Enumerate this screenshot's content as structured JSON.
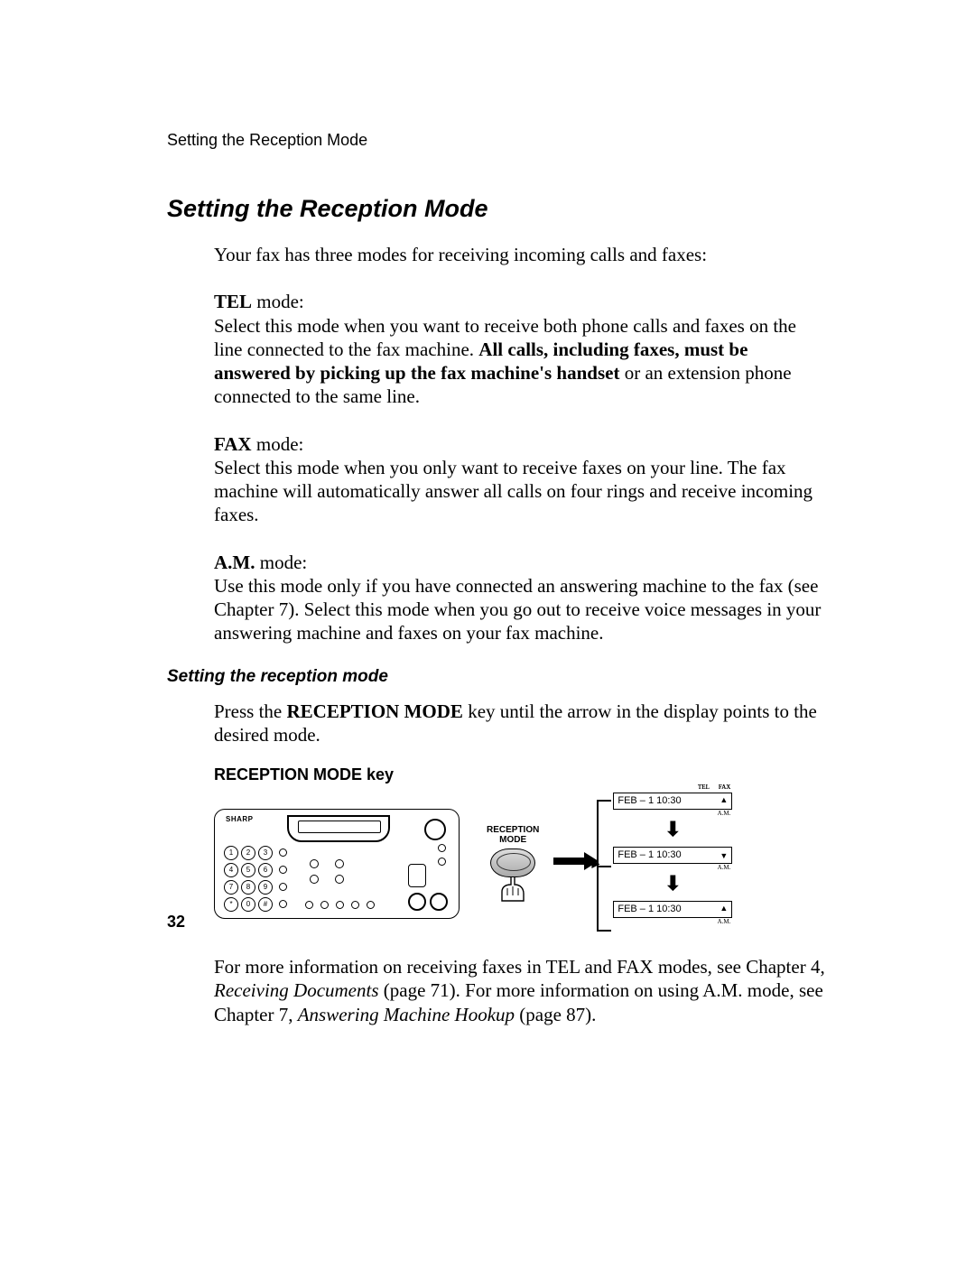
{
  "header": {
    "running": "Setting the Reception Mode"
  },
  "title": "Setting the Reception Mode",
  "intro": "Your fax has three modes for receiving incoming calls and faxes:",
  "modes": {
    "tel": {
      "label": "TEL",
      "suffix": " mode:",
      "body_a": "Select this mode when you want to receive both phone calls and faxes on the line connected to the fax machine. ",
      "body_bold": "All calls, including faxes, must be answered by picking up the fax machine's handset",
      "body_b": " or an extension phone connected to the same line."
    },
    "fax": {
      "label": "FAX",
      "suffix": " mode:",
      "body": "Select this mode when you only want to receive faxes on your line. The fax machine will automatically answer all calls on four rings and receive incoming faxes."
    },
    "am": {
      "label": "A.M.",
      "suffix": " mode:",
      "body": "Use this mode only if you have connected an answering machine to the fax (see Chapter 7). Select this mode when you go out to receive voice messages in your answering machine and faxes on your fax machine."
    }
  },
  "sub": {
    "heading": "Setting the reception mode",
    "press_a": "Press the ",
    "press_bold": "RECEPTION MODE",
    "press_b": " key until the arrow in the display points to the desired mode."
  },
  "diagram": {
    "label": "RECEPTION MODE key",
    "brand": "SHARP",
    "button_label_1": "RECEPTION",
    "button_label_2": "MODE",
    "keypad": [
      "1",
      "2",
      "3",
      "4",
      "5",
      "6",
      "7",
      "8",
      "9",
      "*",
      "0",
      "#"
    ],
    "tiny_tel": "TEL",
    "tiny_fax": "FAX",
    "tiny_am": "A.M.",
    "states": [
      {
        "text": "FEB – 1  10:30",
        "mark": "▲"
      },
      {
        "text": "FEB – 1  10:30",
        "mark": "▼"
      },
      {
        "text": "FEB – 1  10:30",
        "mark": "▲"
      }
    ]
  },
  "closing": {
    "a": "For more information on receiving faxes in TEL and FAX modes, see Chapter 4, ",
    "ref1": "Receiving Documents",
    "b": " (page 71). For more information on using A.M. mode, see Chapter 7, ",
    "ref2": "Answering Machine Hookup",
    "c": " (page 87)."
  },
  "page_number": "32"
}
